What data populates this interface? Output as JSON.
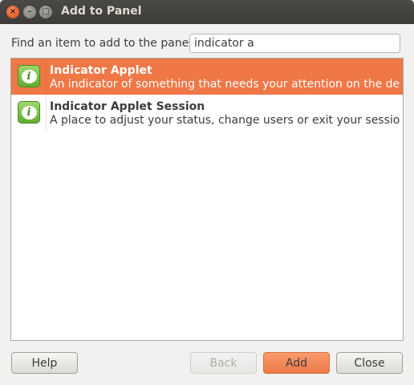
{
  "window": {
    "title": "Add to Panel"
  },
  "window_controls": {
    "close_glyph": "×",
    "minimize_glyph": "–",
    "maximize_glyph": "□"
  },
  "search": {
    "label": "Find an item to add to the panel:",
    "value": "indicator a"
  },
  "items": [
    {
      "name": "Indicator Applet",
      "description": "An indicator of something that needs your attention on the des...",
      "icon": "info-icon",
      "selected": true
    },
    {
      "name": "Indicator Applet Session",
      "description": "A place to adjust your status, change users or exit your session.",
      "icon": "info-icon",
      "selected": false
    }
  ],
  "icon_glyph": "i",
  "buttons": {
    "help": "Help",
    "back": "Back",
    "add": "Add",
    "close": "Close"
  },
  "colors": {
    "selection": "#f07746",
    "titlebar": "#3c3b37",
    "add_button": "#f89b6e"
  }
}
